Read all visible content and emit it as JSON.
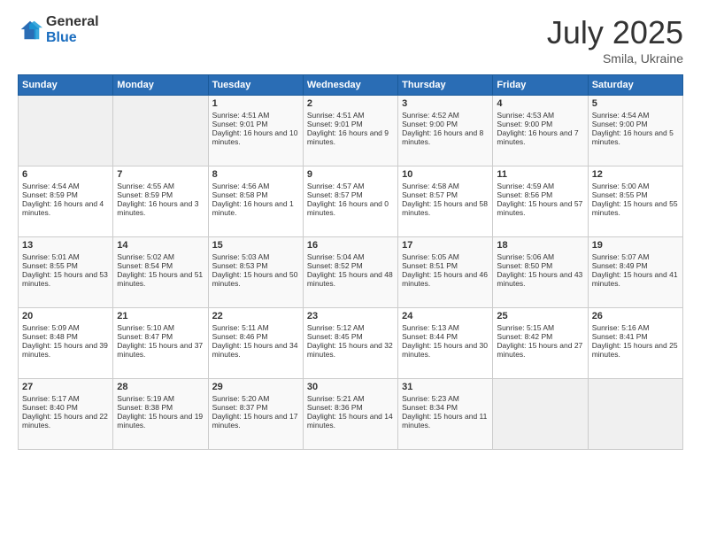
{
  "header": {
    "logo_general": "General",
    "logo_blue": "Blue",
    "title": "July 2025",
    "location": "Smila, Ukraine"
  },
  "weekdays": [
    "Sunday",
    "Monday",
    "Tuesday",
    "Wednesday",
    "Thursday",
    "Friday",
    "Saturday"
  ],
  "weeks": [
    [
      {
        "day": "",
        "empty": true
      },
      {
        "day": "",
        "empty": true
      },
      {
        "day": "1",
        "sunrise": "Sunrise: 4:51 AM",
        "sunset": "Sunset: 9:01 PM",
        "daylight": "Daylight: 16 hours and 10 minutes."
      },
      {
        "day": "2",
        "sunrise": "Sunrise: 4:51 AM",
        "sunset": "Sunset: 9:01 PM",
        "daylight": "Daylight: 16 hours and 9 minutes."
      },
      {
        "day": "3",
        "sunrise": "Sunrise: 4:52 AM",
        "sunset": "Sunset: 9:00 PM",
        "daylight": "Daylight: 16 hours and 8 minutes."
      },
      {
        "day": "4",
        "sunrise": "Sunrise: 4:53 AM",
        "sunset": "Sunset: 9:00 PM",
        "daylight": "Daylight: 16 hours and 7 minutes."
      },
      {
        "day": "5",
        "sunrise": "Sunrise: 4:54 AM",
        "sunset": "Sunset: 9:00 PM",
        "daylight": "Daylight: 16 hours and 5 minutes."
      }
    ],
    [
      {
        "day": "6",
        "sunrise": "Sunrise: 4:54 AM",
        "sunset": "Sunset: 8:59 PM",
        "daylight": "Daylight: 16 hours and 4 minutes."
      },
      {
        "day": "7",
        "sunrise": "Sunrise: 4:55 AM",
        "sunset": "Sunset: 8:59 PM",
        "daylight": "Daylight: 16 hours and 3 minutes."
      },
      {
        "day": "8",
        "sunrise": "Sunrise: 4:56 AM",
        "sunset": "Sunset: 8:58 PM",
        "daylight": "Daylight: 16 hours and 1 minute."
      },
      {
        "day": "9",
        "sunrise": "Sunrise: 4:57 AM",
        "sunset": "Sunset: 8:57 PM",
        "daylight": "Daylight: 16 hours and 0 minutes."
      },
      {
        "day": "10",
        "sunrise": "Sunrise: 4:58 AM",
        "sunset": "Sunset: 8:57 PM",
        "daylight": "Daylight: 15 hours and 58 minutes."
      },
      {
        "day": "11",
        "sunrise": "Sunrise: 4:59 AM",
        "sunset": "Sunset: 8:56 PM",
        "daylight": "Daylight: 15 hours and 57 minutes."
      },
      {
        "day": "12",
        "sunrise": "Sunrise: 5:00 AM",
        "sunset": "Sunset: 8:55 PM",
        "daylight": "Daylight: 15 hours and 55 minutes."
      }
    ],
    [
      {
        "day": "13",
        "sunrise": "Sunrise: 5:01 AM",
        "sunset": "Sunset: 8:55 PM",
        "daylight": "Daylight: 15 hours and 53 minutes."
      },
      {
        "day": "14",
        "sunrise": "Sunrise: 5:02 AM",
        "sunset": "Sunset: 8:54 PM",
        "daylight": "Daylight: 15 hours and 51 minutes."
      },
      {
        "day": "15",
        "sunrise": "Sunrise: 5:03 AM",
        "sunset": "Sunset: 8:53 PM",
        "daylight": "Daylight: 15 hours and 50 minutes."
      },
      {
        "day": "16",
        "sunrise": "Sunrise: 5:04 AM",
        "sunset": "Sunset: 8:52 PM",
        "daylight": "Daylight: 15 hours and 48 minutes."
      },
      {
        "day": "17",
        "sunrise": "Sunrise: 5:05 AM",
        "sunset": "Sunset: 8:51 PM",
        "daylight": "Daylight: 15 hours and 46 minutes."
      },
      {
        "day": "18",
        "sunrise": "Sunrise: 5:06 AM",
        "sunset": "Sunset: 8:50 PM",
        "daylight": "Daylight: 15 hours and 43 minutes."
      },
      {
        "day": "19",
        "sunrise": "Sunrise: 5:07 AM",
        "sunset": "Sunset: 8:49 PM",
        "daylight": "Daylight: 15 hours and 41 minutes."
      }
    ],
    [
      {
        "day": "20",
        "sunrise": "Sunrise: 5:09 AM",
        "sunset": "Sunset: 8:48 PM",
        "daylight": "Daylight: 15 hours and 39 minutes."
      },
      {
        "day": "21",
        "sunrise": "Sunrise: 5:10 AM",
        "sunset": "Sunset: 8:47 PM",
        "daylight": "Daylight: 15 hours and 37 minutes."
      },
      {
        "day": "22",
        "sunrise": "Sunrise: 5:11 AM",
        "sunset": "Sunset: 8:46 PM",
        "daylight": "Daylight: 15 hours and 34 minutes."
      },
      {
        "day": "23",
        "sunrise": "Sunrise: 5:12 AM",
        "sunset": "Sunset: 8:45 PM",
        "daylight": "Daylight: 15 hours and 32 minutes."
      },
      {
        "day": "24",
        "sunrise": "Sunrise: 5:13 AM",
        "sunset": "Sunset: 8:44 PM",
        "daylight": "Daylight: 15 hours and 30 minutes."
      },
      {
        "day": "25",
        "sunrise": "Sunrise: 5:15 AM",
        "sunset": "Sunset: 8:42 PM",
        "daylight": "Daylight: 15 hours and 27 minutes."
      },
      {
        "day": "26",
        "sunrise": "Sunrise: 5:16 AM",
        "sunset": "Sunset: 8:41 PM",
        "daylight": "Daylight: 15 hours and 25 minutes."
      }
    ],
    [
      {
        "day": "27",
        "sunrise": "Sunrise: 5:17 AM",
        "sunset": "Sunset: 8:40 PM",
        "daylight": "Daylight: 15 hours and 22 minutes."
      },
      {
        "day": "28",
        "sunrise": "Sunrise: 5:19 AM",
        "sunset": "Sunset: 8:38 PM",
        "daylight": "Daylight: 15 hours and 19 minutes."
      },
      {
        "day": "29",
        "sunrise": "Sunrise: 5:20 AM",
        "sunset": "Sunset: 8:37 PM",
        "daylight": "Daylight: 15 hours and 17 minutes."
      },
      {
        "day": "30",
        "sunrise": "Sunrise: 5:21 AM",
        "sunset": "Sunset: 8:36 PM",
        "daylight": "Daylight: 15 hours and 14 minutes."
      },
      {
        "day": "31",
        "sunrise": "Sunrise: 5:23 AM",
        "sunset": "Sunset: 8:34 PM",
        "daylight": "Daylight: 15 hours and 11 minutes."
      },
      {
        "day": "",
        "empty": true
      },
      {
        "day": "",
        "empty": true
      }
    ]
  ]
}
